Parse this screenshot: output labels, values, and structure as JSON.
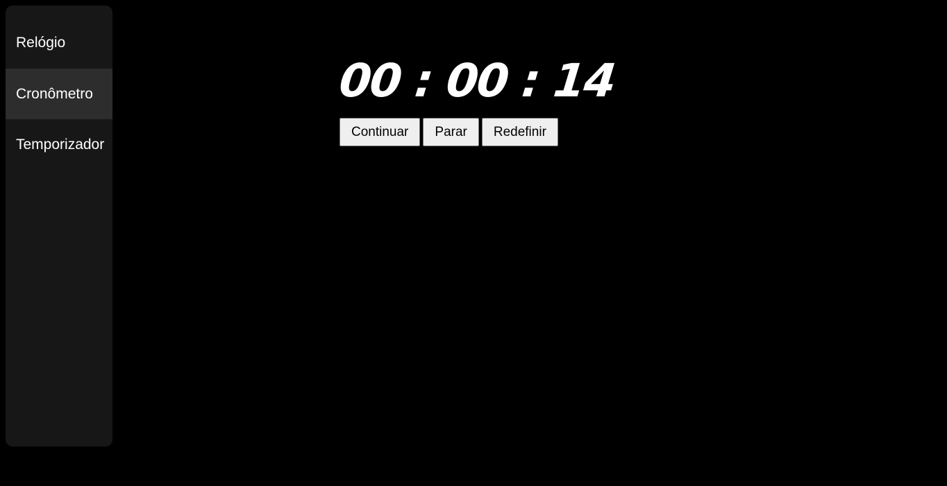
{
  "sidebar": {
    "items": [
      {
        "label": "Relógio",
        "active": false
      },
      {
        "label": "Cronômetro",
        "active": true
      },
      {
        "label": "Temporizador",
        "active": false
      }
    ]
  },
  "stopwatch": {
    "time": "00 : 00 : 14",
    "buttons": {
      "continue_label": "Continuar",
      "stop_label": "Parar",
      "reset_label": "Redefinir"
    }
  },
  "colors": {
    "background": "#000000",
    "sidebar": "#171717",
    "sidebar_active": "#2d2d2d",
    "text": "#ffffff",
    "button_bg": "#efefef"
  }
}
